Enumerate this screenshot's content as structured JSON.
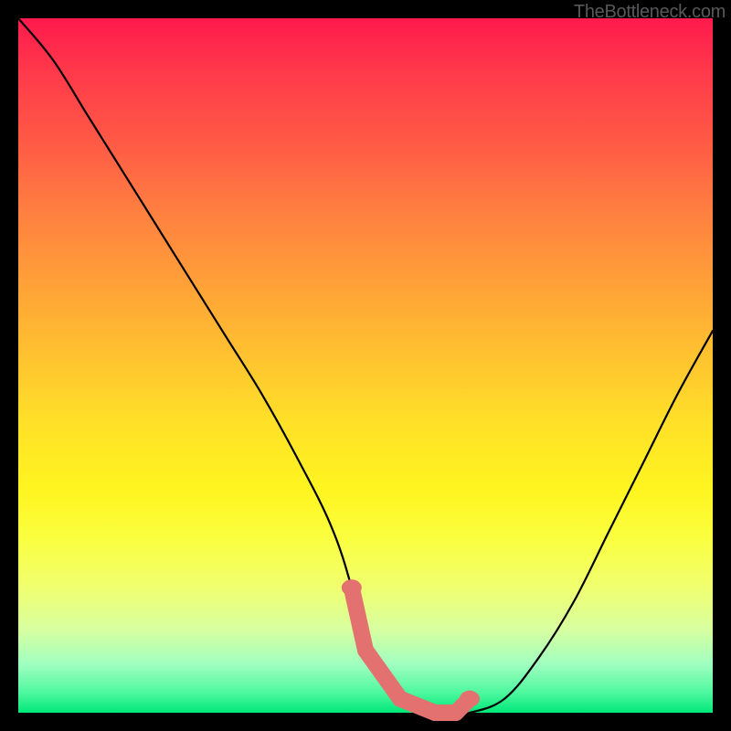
{
  "watermark": "TheBottleneck.com",
  "chart_data": {
    "type": "line",
    "title": "",
    "xlabel": "",
    "ylabel": "",
    "ylim": [
      0,
      100
    ],
    "xlim": [
      0,
      100
    ],
    "series": [
      {
        "name": "black-curve",
        "x": [
          0,
          5,
          10,
          15,
          20,
          25,
          30,
          35,
          40,
          45,
          48,
          50,
          55,
          60,
          63,
          65,
          70,
          75,
          80,
          85,
          90,
          95,
          100
        ],
        "values": [
          100,
          94,
          86,
          78,
          70,
          62,
          54,
          46,
          37,
          27,
          18,
          9,
          2,
          0,
          0,
          0,
          2,
          8,
          16,
          26,
          36,
          46,
          55
        ]
      }
    ],
    "markers": {
      "name": "salmon-markers",
      "color": "#e2716f",
      "x": [
        48,
        50,
        55,
        60,
        63,
        65
      ],
      "values": [
        18,
        9,
        2,
        0,
        0,
        2
      ]
    }
  }
}
